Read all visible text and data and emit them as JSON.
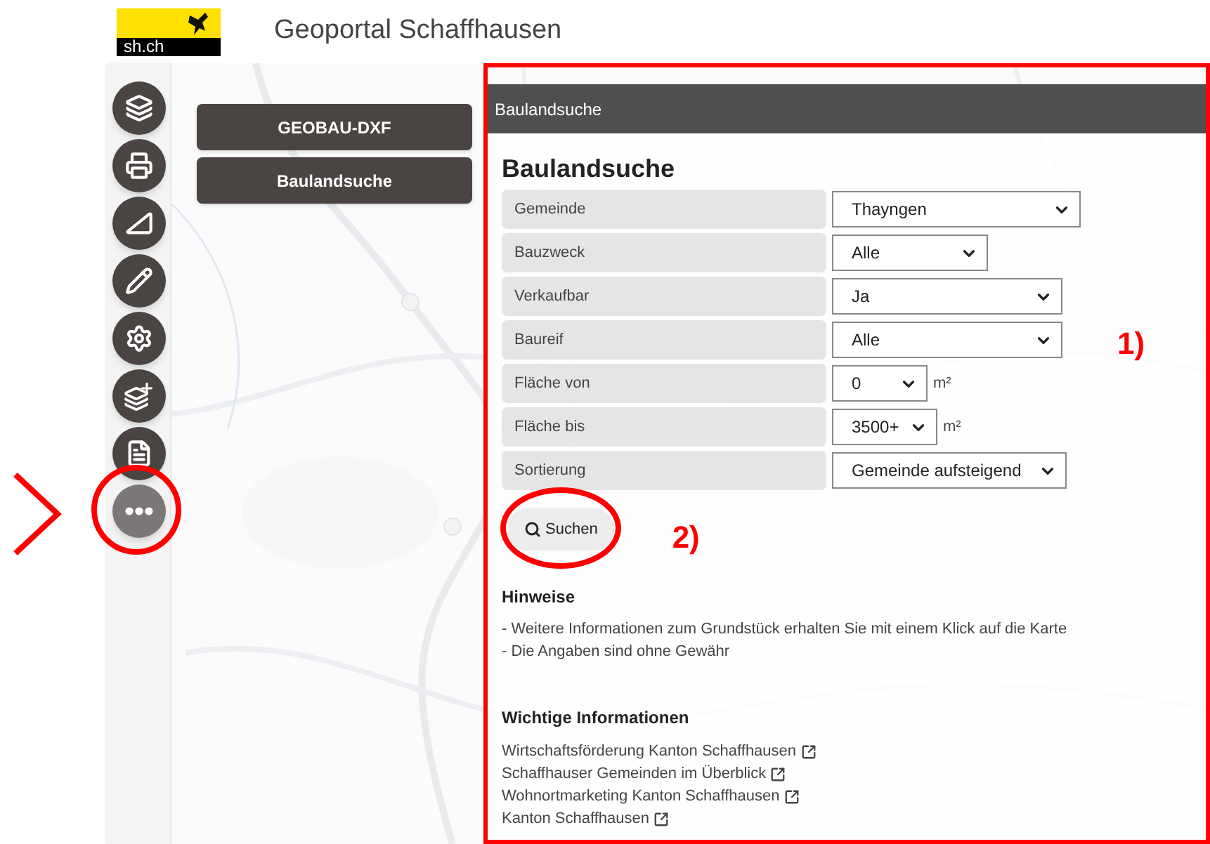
{
  "header": {
    "logo_text": "sh.ch",
    "title": "Geoportal Schaffhausen"
  },
  "toolbar": [
    {
      "kind": "layers"
    },
    {
      "kind": "print"
    },
    {
      "kind": "measure"
    },
    {
      "kind": "draw"
    },
    {
      "kind": "settings"
    },
    {
      "kind": "add-layer"
    },
    {
      "kind": "document"
    },
    {
      "kind": "more"
    }
  ],
  "map_buttons": [
    "GEOBAU-DXF",
    "Baulandsuche"
  ],
  "panel": {
    "title": "Baulandsuche",
    "heading": "Baulandsuche",
    "fields": [
      {
        "label": "Gemeinde",
        "value": "Thayngen"
      },
      {
        "label": "Bauzweck",
        "value": "Alle"
      },
      {
        "label": "Verkaufbar",
        "value": "Ja"
      },
      {
        "label": "Baureif",
        "value": "Alle"
      },
      {
        "label": "Fläche von",
        "value": "0",
        "unit": "m²"
      },
      {
        "label": "Fläche bis",
        "value": "3500+",
        "unit": "m²"
      },
      {
        "label": "Sortierung",
        "value": "Gemeinde aufsteigend"
      }
    ],
    "search_button": "Suchen",
    "hints_heading": "Hinweise",
    "hints": [
      "- Weitere Informationen zum Grundstück erhalten Sie mit einem Klick auf die Karte",
      "- Die Angaben sind ohne Gewähr"
    ],
    "info_heading": "Wichtige Informationen",
    "links": [
      "Wirtschaftsförderung Kanton Schaffhausen",
      "Schaffhauser Gemeinden im Überblick",
      "Wohnortmarketing Kanton Schaffhausen",
      "Kanton Schaffhausen"
    ]
  },
  "annotations": [
    "1)",
    "2)"
  ]
}
